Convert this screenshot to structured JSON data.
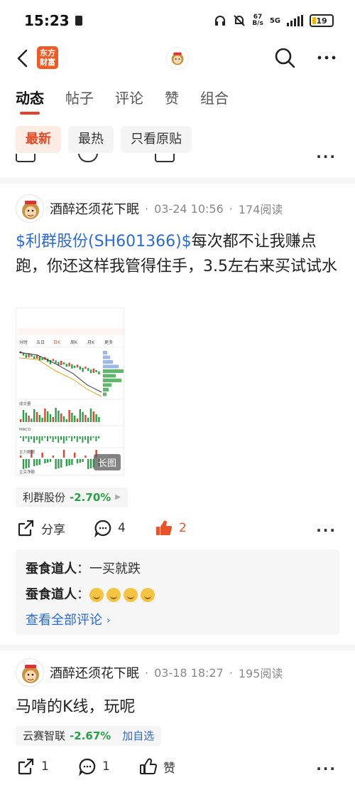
{
  "status_bar": {
    "time": "15:23",
    "speed_top": "67",
    "speed_bottom": "B/s",
    "network": "5G",
    "battery": "19"
  },
  "nav": {
    "logo_line1": "东方",
    "logo_line2": "财富"
  },
  "tabs": [
    "动态",
    "帖子",
    "评论",
    "赞",
    "组合"
  ],
  "filters": [
    "最新",
    "最热",
    "只看原贴"
  ],
  "posts": [
    {
      "author": "酒醉还须花下眠",
      "sep": "·",
      "datetime": "03-24 10:56",
      "reads": "174阅读",
      "stock_tag": "$利群股份(SH601366)$",
      "text": "每次都不让我赚点跑，你还这样我管得住手，3.5左右来买试试水",
      "image_badge": "长图",
      "chip_name": "利群股份",
      "chip_change": "-2.70%",
      "share_label": "分享",
      "comment_count": "4",
      "like_count": "2",
      "comments": [
        {
          "user": "蚕食道人",
          "colon": "：",
          "text": "一买就跌"
        },
        {
          "user": "蚕食道人",
          "colon": "：",
          "text": ""
        }
      ],
      "see_all": "查看全部评论",
      "like_color": "#e8542a"
    },
    {
      "author": "酒醉还须花下眠",
      "sep": "·",
      "datetime": "03-18 18:27",
      "reads": "195阅读",
      "text": "马啃的K线，玩呢",
      "chip_name": "云赛智联",
      "chip_change": "-2.67%",
      "chip_add": "加自选",
      "share_count": "1",
      "comment_count": "1",
      "like_label": "赞"
    }
  ],
  "chart_thumb": {
    "tabs": [
      "分时",
      "五日",
      "日K",
      "周K",
      "月K",
      "更多"
    ],
    "labels": [
      "成交量",
      "MACD",
      "主力数据",
      "主买净额"
    ]
  }
}
